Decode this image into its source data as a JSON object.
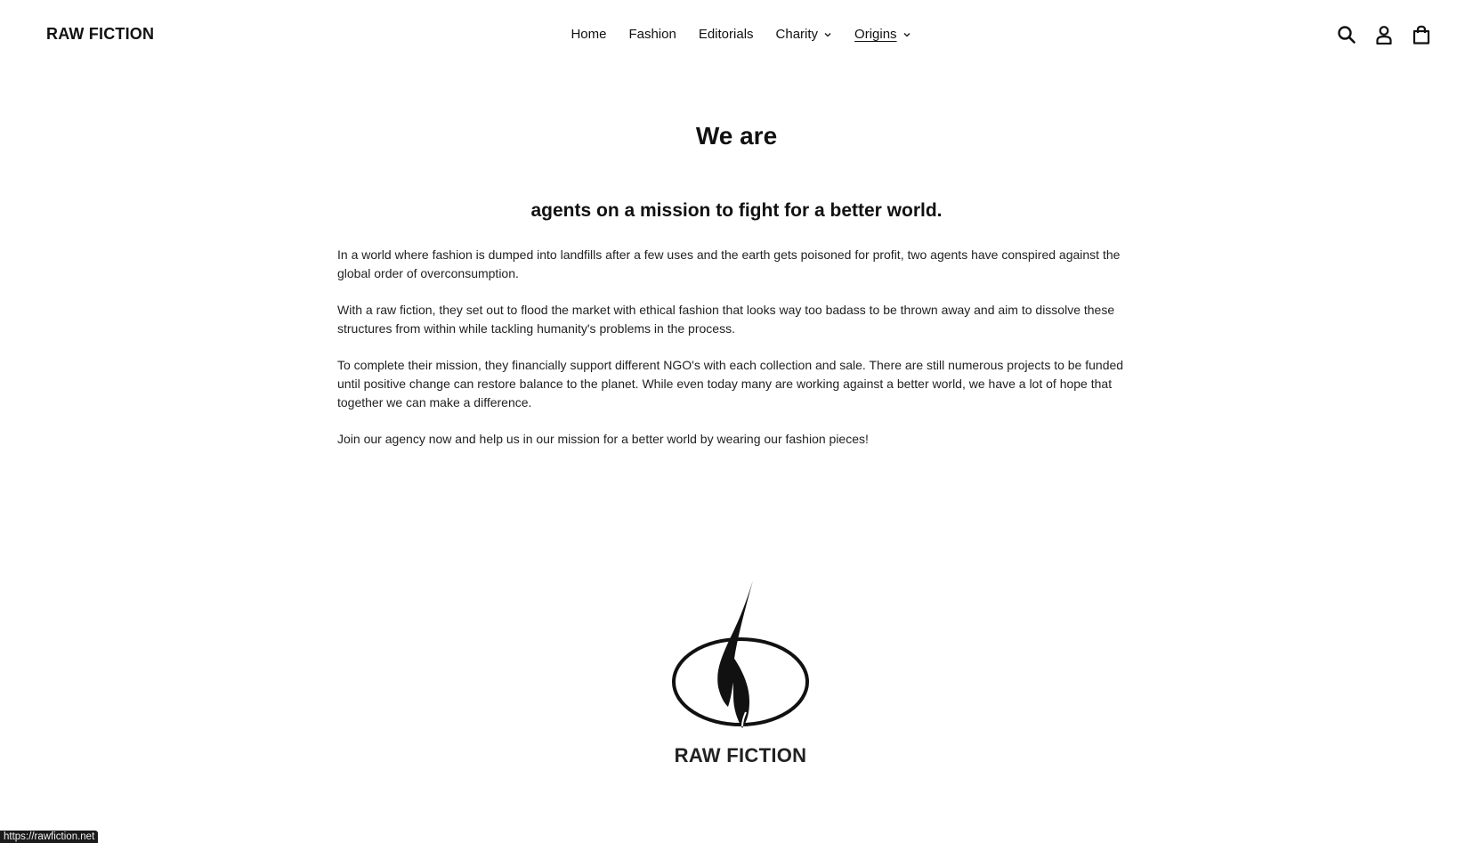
{
  "header": {
    "logo": "RAW FICTION",
    "nav": [
      {
        "label": "Home",
        "dropdown": false,
        "active": false
      },
      {
        "label": "Fashion",
        "dropdown": false,
        "active": false
      },
      {
        "label": "Editorials",
        "dropdown": false,
        "active": false
      },
      {
        "label": "Charity",
        "dropdown": true,
        "active": false
      },
      {
        "label": "Origins",
        "dropdown": true,
        "active": true
      }
    ],
    "icons": [
      "search-icon",
      "account-icon",
      "cart-icon"
    ]
  },
  "main": {
    "title": "We are",
    "subtitle": "agents on a mission to fight for a better world.",
    "paragraphs": [
      "In a world where fashion is dumped into landfills after a few uses and the earth gets poisoned for profit, two agents have conspired against the global order of overconsumption.",
      "With a raw fiction, they set out to flood the market with ethical fashion that looks way too badass to be thrown away and aim to dissolve these structures from within while tackling humanity's problems in the process.",
      "To complete their mission, they financially support different NGO's with each collection and sale. There are still numerous projects to be funded until positive change can restore balance to the planet. While even today many are working against a better world, we have a lot of hope that together we can make a difference.",
      "Join our agency now and help us in our mission for a better world by wearing our fashion pieces!"
    ]
  },
  "footer": {
    "logo_text": "RAW FICTION"
  },
  "status_bar": {
    "url": "https://rawfiction.net"
  },
  "colors": {
    "text": "#111111",
    "background": "#ffffff",
    "status_bg": "#1b1b1b"
  }
}
